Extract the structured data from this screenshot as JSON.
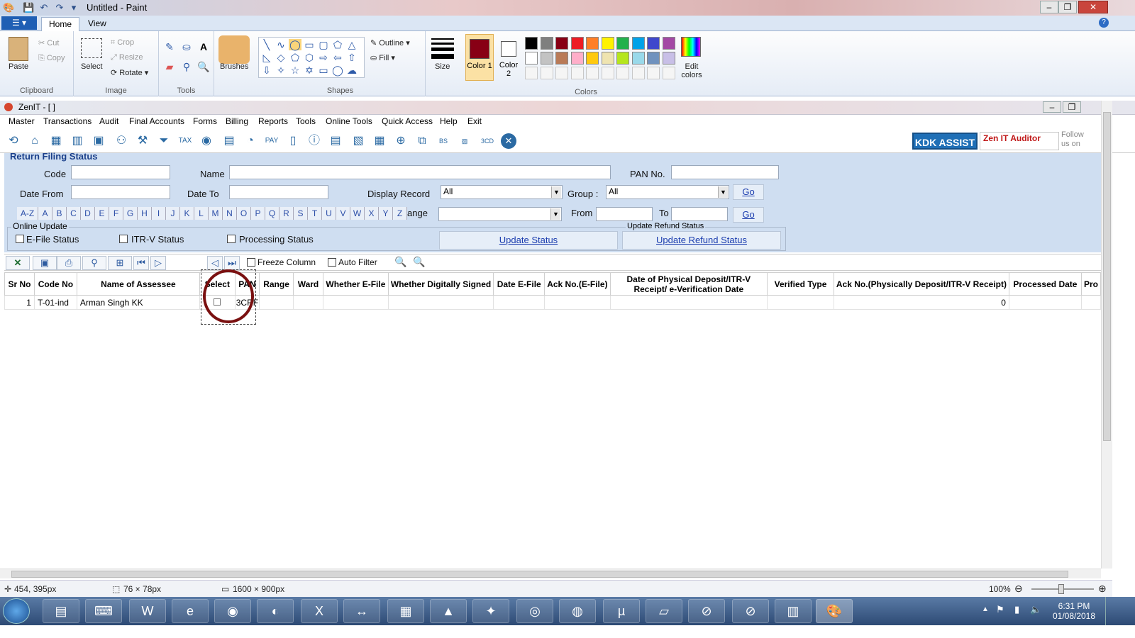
{
  "paint": {
    "window_title": "Untitled - Paint",
    "tabs": [
      "Home",
      "View"
    ],
    "clipboard": {
      "paste": "Paste",
      "cut": "Cut",
      "copy": "Copy",
      "group": "Clipboard"
    },
    "image": {
      "select": "Select",
      "crop": "Crop",
      "resize": "Resize",
      "rotate": "Rotate",
      "group": "Image"
    },
    "tools_group": "Tools",
    "brushes": "Brushes",
    "shapes": {
      "outline": "Outline",
      "fill": "Fill",
      "group": "Shapes"
    },
    "size": "Size",
    "color1": "Color 1",
    "color2": "Color 2",
    "edit_colors": "Edit colors",
    "colors_group": "Colors",
    "palette": [
      "#000000",
      "#7f7f7f",
      "#880015",
      "#ed1c24",
      "#ff7f27",
      "#fff200",
      "#22b14c",
      "#00a2e8",
      "#3f48cc",
      "#a349a4",
      "#ffffff",
      "#c3c3c3",
      "#b97a57",
      "#ffaec9",
      "#ffc90e",
      "#efe4b0",
      "#b5e61d",
      "#99d9ea",
      "#7092be",
      "#c8bfe7"
    ],
    "active_color": "#880015",
    "status": {
      "cursor": "454, 395px",
      "selection": "76 × 78px",
      "canvas": "1600 × 900px",
      "zoom": "100%"
    }
  },
  "zenit": {
    "window_title": "ZenIT - [ ]",
    "menu": [
      "Master",
      "Transactions",
      "Audit",
      "Final Accounts",
      "Forms",
      "Billing",
      "Reports",
      "Tools",
      "Online Tools",
      "Quick Access",
      "Help",
      "Exit"
    ],
    "kdk_assist": "KDK ASSIST",
    "zen_it_auditor": "Zen IT Auditor",
    "follow": "Follow us on",
    "panel_title": "Return Filing Status",
    "labels": {
      "code": "Code",
      "name": "Name",
      "pan": "PAN No.",
      "date_from": "Date From",
      "date_to": "Date To",
      "display_record": "Display Record",
      "group": "Group :",
      "range": "ange",
      "from": "From",
      "to": "To"
    },
    "display_record_value": "All",
    "group_value": "All",
    "go": "Go",
    "alpha": [
      "A-Z",
      "A",
      "B",
      "C",
      "D",
      "E",
      "F",
      "G",
      "H",
      "I",
      "J",
      "K",
      "L",
      "M",
      "N",
      "O",
      "P",
      "Q",
      "R",
      "S",
      "T",
      "U",
      "V",
      "W",
      "X",
      "Y",
      "Z"
    ],
    "online_update": "Online Update",
    "efile_status": "E-File Status",
    "itrv_status": "ITR-V Status",
    "processing_status": "Processing Status",
    "update_status": "Update Status",
    "update_refund_title": "Update Refund Status",
    "update_refund": "Update Refund Status",
    "freeze_column": "Freeze Column",
    "auto_filter": "Auto Filter",
    "columns": [
      "Sr No",
      "Code No",
      "Name of Assessee",
      "Select",
      "PAN",
      "Range",
      "Ward",
      "Whether E-File",
      "Whether Digitally Signed",
      "Date E-File",
      "Ack No.(E-File)",
      "Date of Physical Deposit/ITR-V Receipt/ e-Verification Date",
      "Verified Type",
      "Ack No.(Physically Deposit/ITR-V Receipt)",
      "Processed Date",
      "Pro"
    ],
    "rows": [
      {
        "sr": "1",
        "code": "T-01-ind",
        "name": "Arman Singh KK",
        "pan": "3CRF",
        "ack_phys": "0"
      }
    ]
  },
  "taskbar": {
    "time": "6:31 PM",
    "date": "01/08/2018"
  }
}
